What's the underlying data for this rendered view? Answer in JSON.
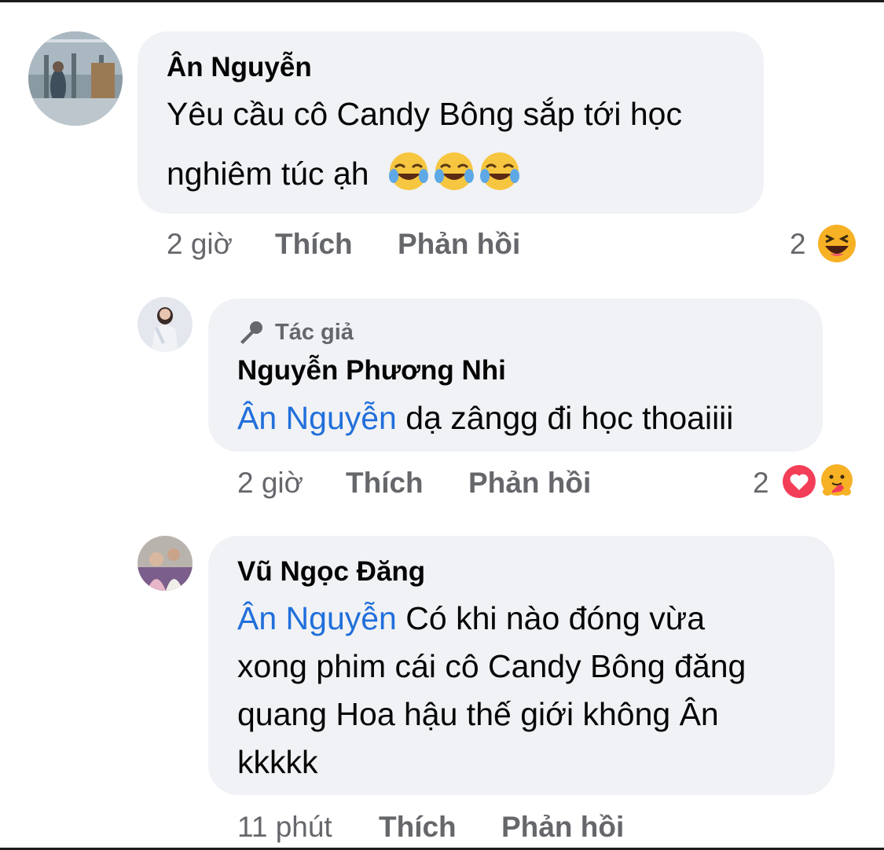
{
  "comments": [
    {
      "author": "Ân Nguyễn",
      "text_line1": "Yêu cầu cô Candy Bông sắp tới học",
      "text_line2": "nghiêm túc ạh",
      "emojis": [
        "face-with-tears-of-joy",
        "face-with-tears-of-joy",
        "face-with-tears-of-joy"
      ],
      "time": "2 giờ",
      "like_label": "Thích",
      "reply_label": "Phản hồi",
      "reaction_count": "2",
      "reactions": [
        "haha"
      ]
    },
    {
      "author_badge": "Tác giả",
      "author": "Nguyễn Phương Nhi",
      "mention": "Ân Nguyễn",
      "text": "dạ zângg đi học thoaiiii",
      "time": "2 giờ",
      "like_label": "Thích",
      "reply_label": "Phản hồi",
      "reaction_count": "2",
      "reactions": [
        "love",
        "care"
      ]
    },
    {
      "author": "Vũ Ngọc Đăng",
      "mention": "Ân Nguyễn",
      "text_line1": "Có khi nào đóng vừa",
      "text_line2": "xong phim cái cô Candy Bông đăng",
      "text_line3": "quang Hoa hậu thế giới không Ân",
      "text_line4": "kkkkk",
      "time": "11 phút",
      "like_label": "Thích",
      "reply_label": "Phản hồi"
    }
  ],
  "colors": {
    "bubble": "#f0f2f5",
    "mention": "#216fdb",
    "meta": "#65676b",
    "love": "#f33e58",
    "haha": "#f7b125"
  }
}
